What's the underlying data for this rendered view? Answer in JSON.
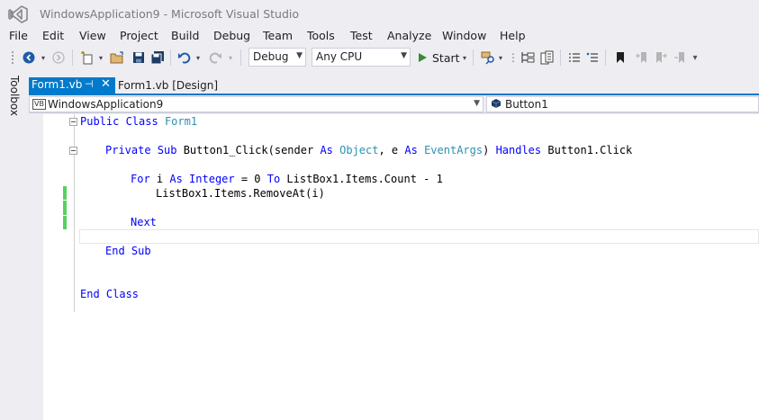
{
  "window": {
    "title": "WindowsApplication9 - Microsoft Visual Studio"
  },
  "menu": [
    "File",
    "Edit",
    "View",
    "Project",
    "Build",
    "Debug",
    "Team",
    "Tools",
    "Test",
    "Analyze",
    "Window",
    "Help"
  ],
  "toolbar": {
    "config": "Debug",
    "platform": "Any CPU",
    "start_label": "Start"
  },
  "sidebar": {
    "toolbox_label": "Toolbox"
  },
  "tabs": [
    {
      "label": "Form1.vb",
      "active": true
    },
    {
      "label": "Form1.vb [Design]",
      "active": false
    }
  ],
  "navbar": {
    "project": "WindowsApplication9",
    "member": "Button1"
  },
  "code": {
    "line1": {
      "kw": "Public Class",
      "type": "Form1"
    },
    "line2": {
      "kw1": "Private Sub",
      "text1": " Button1_Click(sender ",
      "kw2": "As",
      "text2": " ",
      "type1": "Object",
      "text3": ", e ",
      "kw3": "As",
      "text4": " ",
      "type2": "EventArgs",
      "text5": ") ",
      "kw4": "Handles",
      "text6": " Button1.Click"
    },
    "line3": {
      "kw1": "For",
      "text1": " i ",
      "kw2": "As Integer",
      "text2": " = 0 ",
      "kw3": "To",
      "text3": " ListBox1.Items.Count - 1"
    },
    "line4": {
      "text": "ListBox1.Items.RemoveAt(i)"
    },
    "line5": {
      "kw": "Next"
    },
    "line6": {
      "kw": "End Sub"
    },
    "line7": {
      "kw": "End Class"
    }
  },
  "colors": {
    "accent": "#007acc",
    "keyword": "#0000ff",
    "type": "#2b91af",
    "changed": "#57d15f"
  }
}
